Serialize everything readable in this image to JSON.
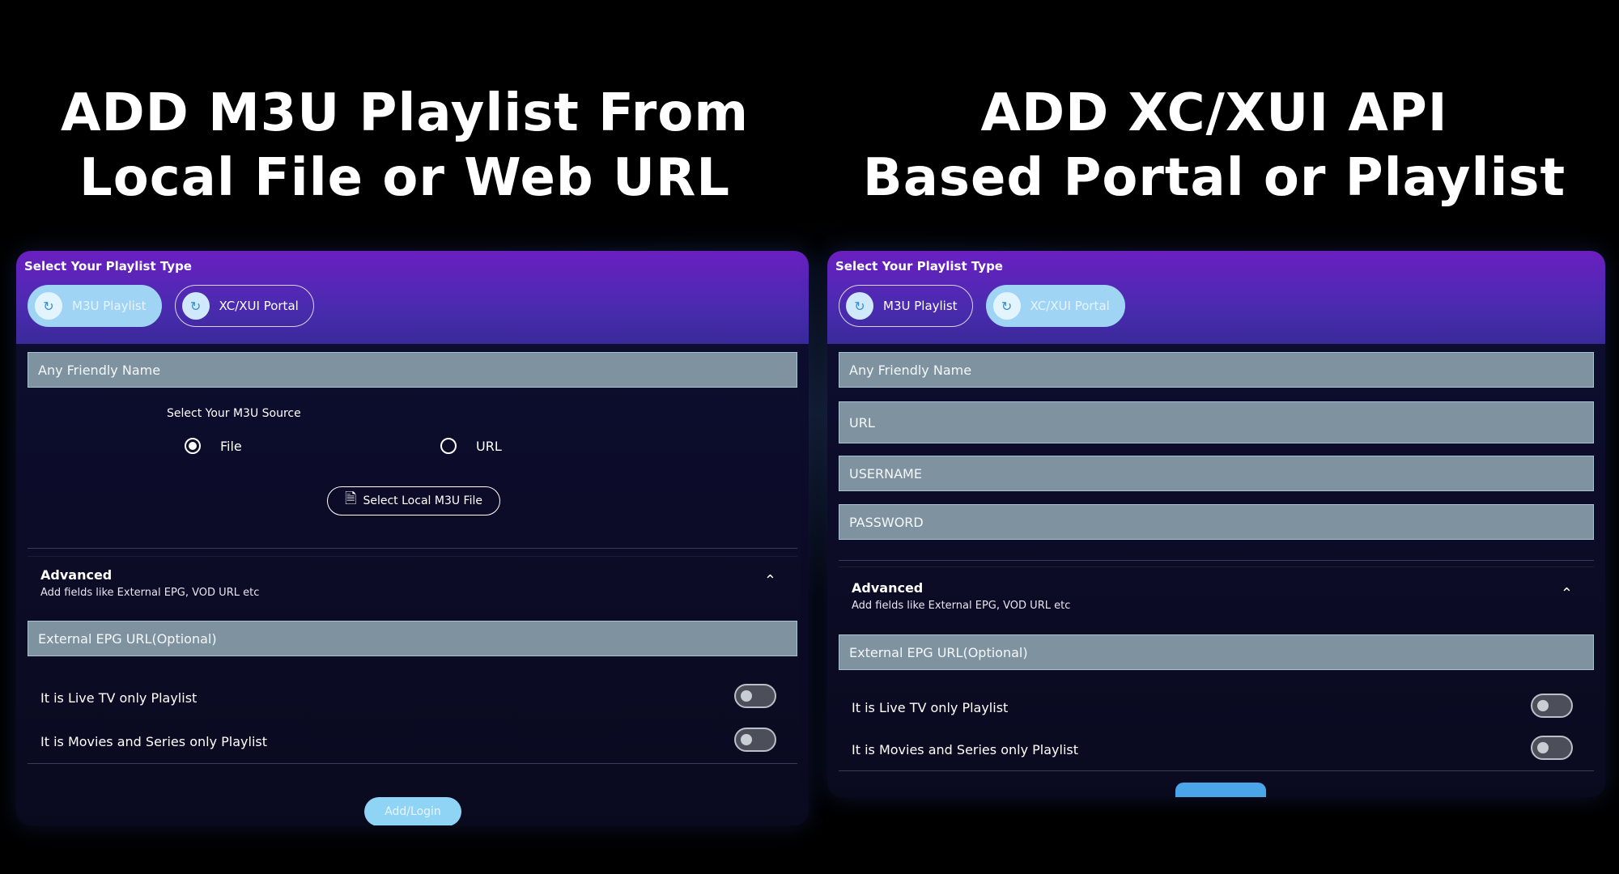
{
  "headings": {
    "left_line1": "ADD M3U Playlist From",
    "left_line2": "Local File or Web URL",
    "right_line1": "ADD XC/XUI API",
    "right_line2": "Based Portal or Playlist"
  },
  "left_panel": {
    "select_type_label": "Select Your Playlist Type",
    "type_buttons": [
      {
        "label": "M3U Playlist",
        "active": true,
        "icon": "playlist-icon"
      },
      {
        "label": "XC/XUI Portal",
        "active": false,
        "icon": "portal-icon"
      }
    ],
    "name_placeholder": "Any Friendly Name",
    "source_label": "Select Your M3U Source",
    "source_options": [
      {
        "label": "File",
        "selected": true
      },
      {
        "label": "URL",
        "selected": false
      }
    ],
    "file_button": "Select Local M3U File",
    "advanced_title": "Advanced",
    "advanced_subtitle": "Add fields like External EPG, VOD URL etc",
    "epg_placeholder": "External EPG URL(Optional)",
    "toggles": [
      {
        "label": "It is Live TV only Playlist",
        "on": false
      },
      {
        "label": "It is Movies and Series only Playlist",
        "on": false
      }
    ],
    "submit_label": "Add/Login"
  },
  "right_panel": {
    "select_type_label": "Select Your Playlist Type",
    "type_buttons": [
      {
        "label": "M3U Playlist",
        "active": false,
        "icon": "playlist-icon"
      },
      {
        "label": "XC/XUI Portal",
        "active": true,
        "icon": "portal-icon"
      }
    ],
    "name_placeholder": "Any Friendly Name",
    "url_placeholder": "URL",
    "username_placeholder": "USERNAME",
    "password_placeholder": "PASSWORD",
    "advanced_title": "Advanced",
    "advanced_subtitle": "Add fields like External EPG, VOD URL etc",
    "epg_placeholder": "External EPG URL(Optional)",
    "toggles": [
      {
        "label": "It is Live TV only Playlist",
        "on": false
      },
      {
        "label": "It is Movies and Series only Playlist",
        "on": false
      }
    ]
  },
  "colors": {
    "background": "#000000",
    "header_gradient_top": "#6a1fc0",
    "field_fill": "#7e939f",
    "active_button": "#9fd4f4"
  }
}
